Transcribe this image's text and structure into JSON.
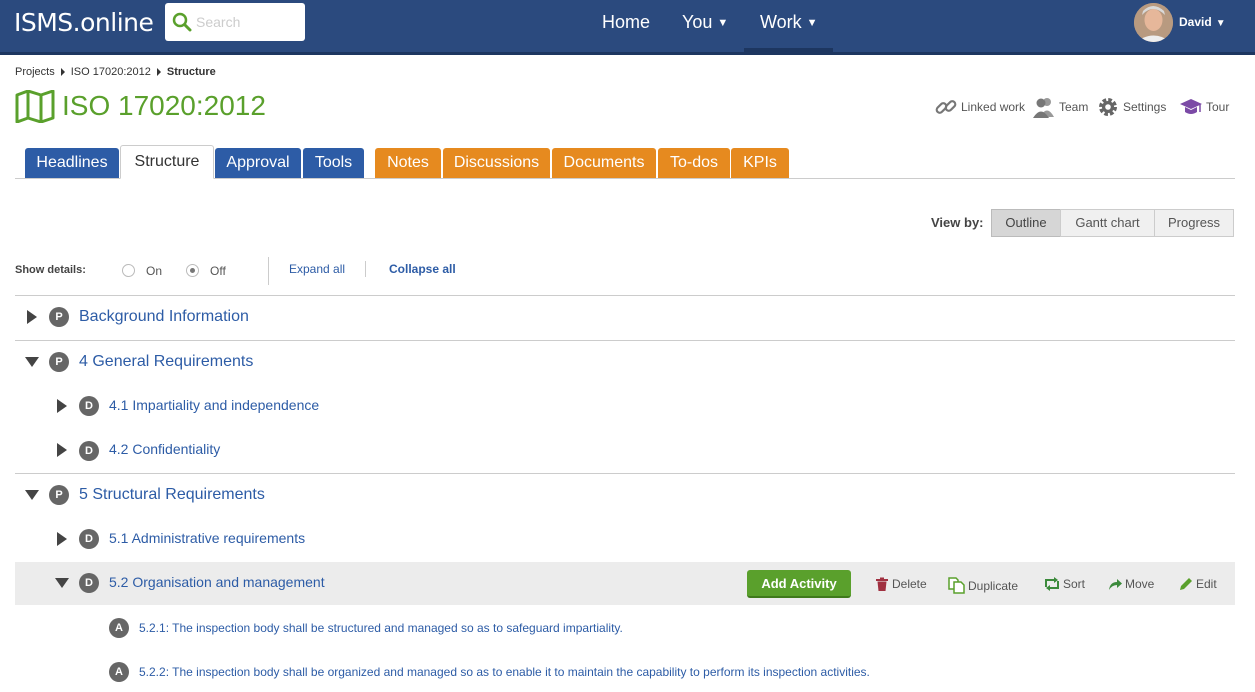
{
  "app": {
    "logo": "ISMS.online"
  },
  "search": {
    "placeholder": "Search"
  },
  "nav": {
    "home": "Home",
    "you": "You",
    "work": "Work"
  },
  "user": {
    "name": "David"
  },
  "breadcrumb": {
    "items": [
      "Projects",
      "ISO 17020:2012"
    ],
    "current": "Structure"
  },
  "page": {
    "title": "ISO 17020:2012"
  },
  "header_tools": {
    "linked_work": "Linked work",
    "team": "Team",
    "settings": "Settings",
    "tour": "Tour"
  },
  "tabs": [
    "Headlines",
    "Structure",
    "Approval",
    "Tools",
    "Notes",
    "Discussions",
    "Documents",
    "To-dos",
    "KPIs"
  ],
  "active_tab": "Structure",
  "view_by": {
    "label": "View by:",
    "options": [
      "Outline",
      "Gantt chart",
      "Progress"
    ],
    "selected": "Outline"
  },
  "details": {
    "label": "Show details:",
    "on": "On",
    "off": "Off",
    "selected": "Off",
    "expand_all": "Expand all",
    "collapse_all": "Collapse all"
  },
  "outline": [
    {
      "badge": "P",
      "label": "Background Information",
      "expanded": false
    },
    {
      "badge": "P",
      "label": "4 General Requirements",
      "expanded": true
    },
    {
      "badge": "D",
      "label": "4.1 Impartiality and independence",
      "expanded": false
    },
    {
      "badge": "D",
      "label": "4.2 Confidentiality",
      "expanded": false
    },
    {
      "badge": "P",
      "label": "5 Structural Requirements",
      "expanded": true
    },
    {
      "badge": "D",
      "label": "5.1 Administrative requirements",
      "expanded": false
    },
    {
      "badge": "D",
      "label": "5.2 Organisation and management",
      "expanded": true
    },
    {
      "badge": "A",
      "label": "5.2.1: The inspection body shall be structured and managed so as to safeguard impartiality."
    },
    {
      "badge": "A",
      "label": "5.2.2: The inspection body shall be organized and managed so as to enable it to maintain the capability to perform its inspection activities."
    }
  ],
  "row_actions": {
    "add_activity": "Add Activity",
    "delete": "Delete",
    "duplicate": "Duplicate",
    "sort": "Sort",
    "move": "Move",
    "edit": "Edit"
  },
  "colors": {
    "nav_bg": "#2b4a7e",
    "accent_green": "#5aa02c",
    "tab_blue": "#2d5ca6",
    "tab_orange": "#e68a1f",
    "link": "#2d5ca6"
  }
}
